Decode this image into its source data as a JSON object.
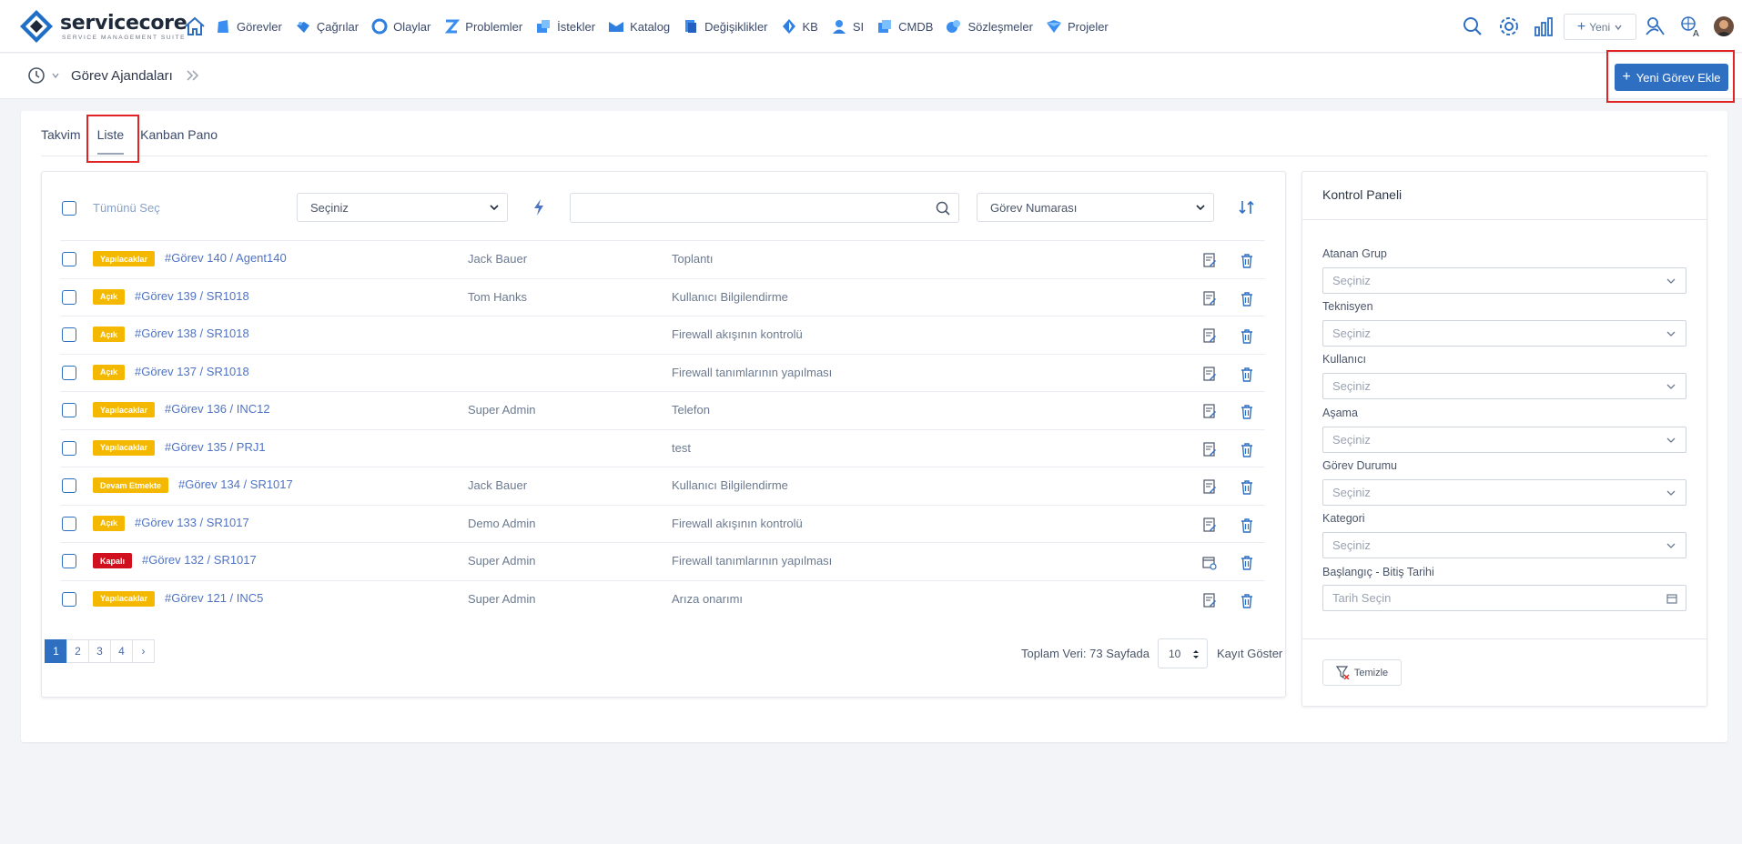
{
  "brand": {
    "name": "servicecore",
    "tagline": "SERVICE MANAGEMENT SUITE"
  },
  "nav": {
    "items": [
      {
        "label": "Görevler",
        "icon": "tasks-icon"
      },
      {
        "label": "Çağrılar",
        "icon": "calls-icon"
      },
      {
        "label": "Olaylar",
        "icon": "incidents-icon"
      },
      {
        "label": "Problemler",
        "icon": "problems-icon"
      },
      {
        "label": "İstekler",
        "icon": "requests-icon"
      },
      {
        "label": "Katalog",
        "icon": "catalog-icon"
      },
      {
        "label": "Değişiklikler",
        "icon": "changes-icon"
      },
      {
        "label": "KB",
        "icon": "knowledge-base-icon"
      },
      {
        "label": "SI",
        "icon": "si-icon"
      },
      {
        "label": "CMDB",
        "icon": "cmdb-icon"
      },
      {
        "label": "Sözleşmeler",
        "icon": "contracts-icon"
      },
      {
        "label": "Projeler",
        "icon": "projects-icon"
      }
    ],
    "new_label": "Yeni"
  },
  "breadcrumb": {
    "title": "Görev Ajandaları"
  },
  "add_button": {
    "label": "Yeni Görev Ekle"
  },
  "tabs": [
    {
      "label": "Takvim",
      "active": false
    },
    {
      "label": "Liste",
      "active": true
    },
    {
      "label": "Kanban Pano",
      "active": false
    }
  ],
  "toolbar": {
    "select_all": "Tümünü Seç",
    "filter_select": "Seçiniz",
    "search_value": "",
    "sort_select": "Görev Numarası"
  },
  "rows": [
    {
      "status": "Yapılacaklar",
      "status_color": "#f5b800",
      "task": "#Görev 140 / Agent140",
      "user": "Jack Bauer",
      "desc": "Toplantı",
      "action_icon": "edit-doc-icon"
    },
    {
      "status": "Açık",
      "status_color": "#f5b800",
      "task": "#Görev 139 / SR1018",
      "user": "Tom Hanks",
      "desc": "Kullanıcı Bilgilendirme",
      "action_icon": "edit-doc-icon"
    },
    {
      "status": "Açık",
      "status_color": "#f5b800",
      "task": "#Görev 138 / SR1018",
      "user": "",
      "desc": "Firewall akışının kontrolü",
      "action_icon": "edit-doc-icon"
    },
    {
      "status": "Açık",
      "status_color": "#f5b800",
      "task": "#Görev 137 / SR1018",
      "user": "",
      "desc": "Firewall tanımlarının yapılması",
      "action_icon": "edit-doc-icon"
    },
    {
      "status": "Yapılacaklar",
      "status_color": "#f5b800",
      "task": "#Görev 136 / INC12",
      "user": "Super Admin",
      "desc": "Telefon",
      "action_icon": "edit-doc-icon"
    },
    {
      "status": "Yapılacaklar",
      "status_color": "#f5b800",
      "task": "#Görev 135 / PRJ1",
      "user": "",
      "desc": "test",
      "action_icon": "edit-doc-icon"
    },
    {
      "status": "Devam Etmekte",
      "status_color": "#f5b800",
      "task": "#Görev 134 / SR1017",
      "user": "Jack Bauer",
      "desc": "Kullanıcı Bilgilendirme",
      "action_icon": "edit-doc-icon"
    },
    {
      "status": "Açık",
      "status_color": "#f5b800",
      "task": "#Görev 133 / SR1017",
      "user": "Demo Admin",
      "desc": "Firewall akışının kontrolü",
      "action_icon": "edit-doc-icon"
    },
    {
      "status": "Kapalı",
      "status_color": "#d0101e",
      "task": "#Görev 132 / SR1017",
      "user": "Super Admin",
      "desc": "Firewall tanımlarının yapılması",
      "action_icon": "calendar-refresh-icon"
    },
    {
      "status": "Yapılacaklar",
      "status_color": "#f5b800",
      "task": "#Görev 121 / INC5",
      "user": "Super Admin",
      "desc": "Arıza onarımı",
      "action_icon": "edit-doc-icon"
    }
  ],
  "pagination": {
    "pages": [
      "1",
      "2",
      "3",
      "4"
    ],
    "next": "›",
    "current": "1"
  },
  "footer": {
    "total": "Toplam Veri: 73 Sayfada",
    "per_page": "10",
    "show_label": "Kayıt Göster"
  },
  "control_panel": {
    "title": "Kontrol Paneli",
    "fields": [
      {
        "label": "Atanan Grup",
        "value": "Seçiniz"
      },
      {
        "label": "Teknisyen",
        "value": "Seçiniz"
      },
      {
        "label": "Kullanıcı",
        "value": "Seçiniz"
      },
      {
        "label": "Aşama",
        "value": "Seçiniz"
      },
      {
        "label": "Görev Durumu",
        "value": "Seçiniz"
      },
      {
        "label": "Kategori",
        "value": "Seçiniz"
      }
    ],
    "date_label": "Başlangıç - Bitiş Tarihi",
    "date_placeholder": "Tarih Seçin",
    "clear_label": "Temizle"
  },
  "colors": {
    "accent": "#2f6fc2",
    "link": "#4f73c4",
    "highlight": "#e02424"
  }
}
